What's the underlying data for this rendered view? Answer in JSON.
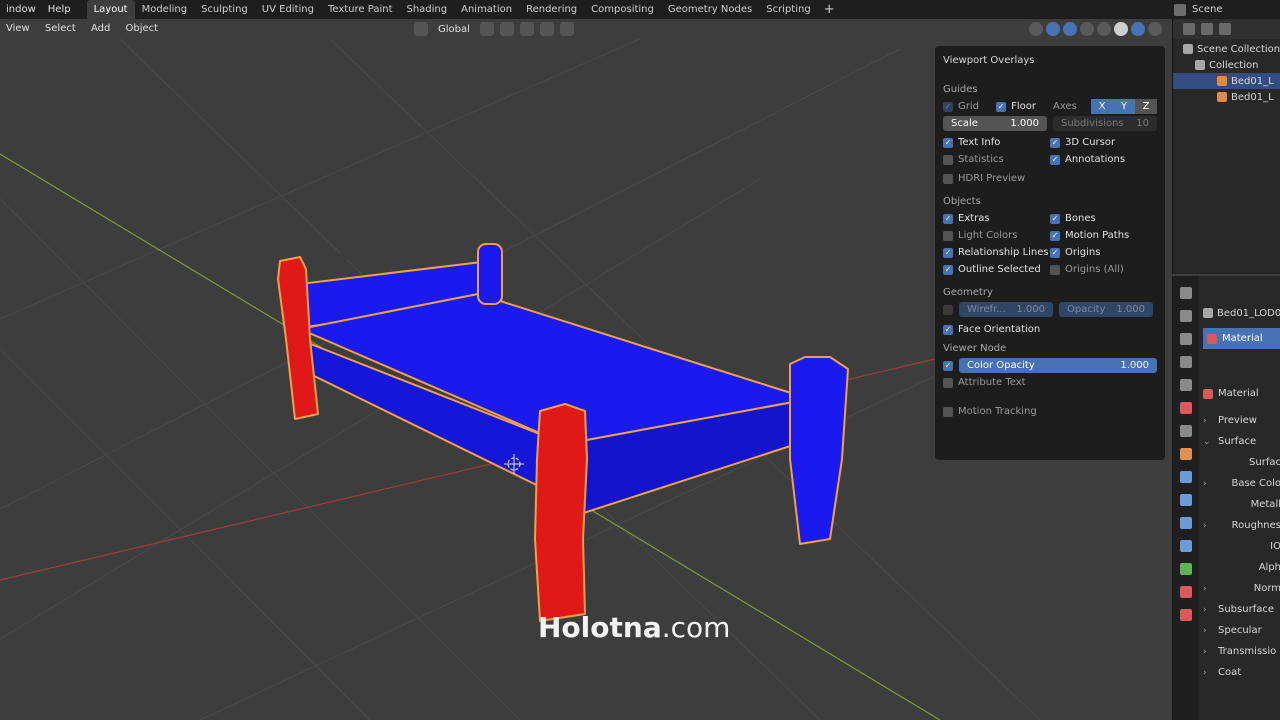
{
  "topbar": {
    "menu": [
      "indow",
      "Help"
    ],
    "tabs": [
      "Layout",
      "Modeling",
      "Sculpting",
      "UV Editing",
      "Texture Paint",
      "Shading",
      "Animation",
      "Rendering",
      "Compositing",
      "Geometry Nodes",
      "Scripting"
    ],
    "active_tab": "Layout",
    "add_tab": "+",
    "scene": "Scene"
  },
  "viewport_header": {
    "menu": [
      "View",
      "Select",
      "Add",
      "Object"
    ],
    "orientation": "Global"
  },
  "overlays": {
    "title": "Viewport Overlays",
    "guides": {
      "heading": "Guides",
      "grid": "Grid",
      "floor": "Floor",
      "axes": "Axes",
      "x": "X",
      "y": "Y",
      "z": "Z",
      "scale_label": "Scale",
      "scale_value": "1.000",
      "subdivisions_label": "Subdivisions",
      "subdivisions_value": "10",
      "text_info": "Text Info",
      "cursor_3d": "3D Cursor",
      "statistics": "Statistics",
      "annotations": "Annotations",
      "hdri_preview": "HDRI Preview"
    },
    "objects": {
      "heading": "Objects",
      "extras": "Extras",
      "bones": "Bones",
      "light_colors": "Light Colors",
      "motion_paths": "Motion Paths",
      "relationship_lines": "Relationship Lines",
      "origins": "Origins",
      "outline_selected": "Outline Selected",
      "origins_all": "Origins (All)"
    },
    "geometry": {
      "heading": "Geometry",
      "wireframe_label": "Wirefr...",
      "wireframe_value": "1.000",
      "opacity_label": "Opacity",
      "opacity_value": "1.000",
      "face_orientation": "Face Orientation"
    },
    "viewer_node": {
      "heading": "Viewer Node",
      "color_opacity_label": "Color Opacity",
      "color_opacity_value": "1.000",
      "attribute_text": "Attribute Text"
    },
    "motion_tracking": "Motion Tracking"
  },
  "outliner": {
    "scene_collection": "Scene Collection",
    "collection": "Collection",
    "items": [
      "Bed01_L",
      "Bed01_L"
    ]
  },
  "properties": {
    "object_name": "Bed01_LOD0",
    "material_slot": "Material",
    "material_name": "Material",
    "rows": [
      "Preview",
      "Surface",
      "Surfac",
      "Base Colo",
      "Metall",
      "Roughnes",
      "IO",
      "Alph",
      "Norm",
      "Subsurface",
      "Specular",
      "Transmissio",
      "Coat"
    ]
  },
  "watermark": {
    "bold": "Holotna",
    "light": ".com"
  },
  "colors": {
    "front_face": "#1a1aee",
    "back_face": "#e01818",
    "outline": "#f0a04a",
    "accent": "#4772b3"
  }
}
